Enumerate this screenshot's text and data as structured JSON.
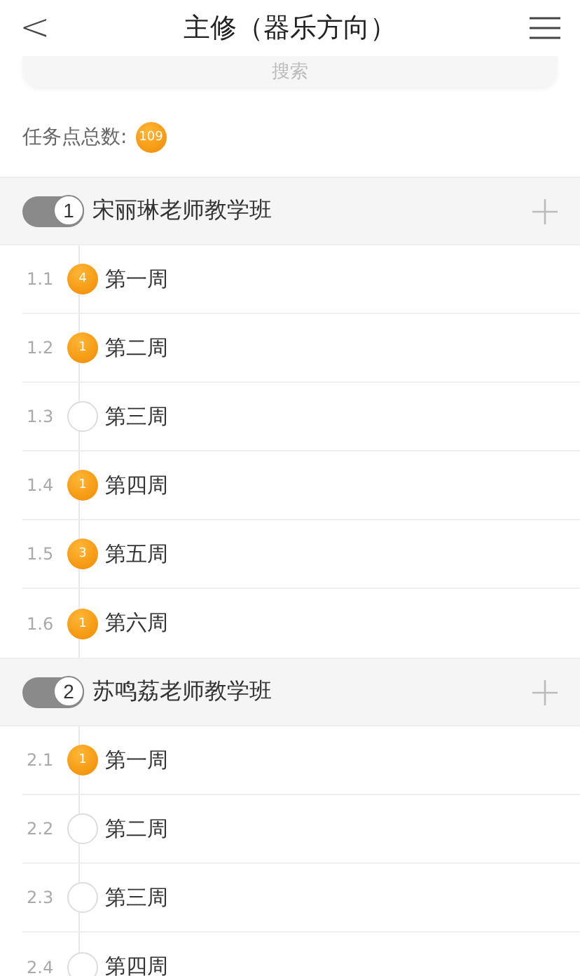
{
  "header": {
    "back": "<",
    "title": "主修（器乐方向）"
  },
  "search": {
    "placeholder": "搜索"
  },
  "total": {
    "label": "任务点总数:",
    "count": "109"
  },
  "sections": [
    {
      "number": "1",
      "title": "宋丽琳老师教学班",
      "items": [
        {
          "index": "1.1",
          "label": "第一周",
          "count": "4"
        },
        {
          "index": "1.2",
          "label": "第二周",
          "count": "1"
        },
        {
          "index": "1.3",
          "label": "第三周"
        },
        {
          "index": "1.4",
          "label": "第四周",
          "count": "1"
        },
        {
          "index": "1.5",
          "label": "第五周",
          "count": "3"
        },
        {
          "index": "1.6",
          "label": "第六周",
          "count": "1"
        }
      ]
    },
    {
      "number": "2",
      "title": "苏鸣荔老师教学班",
      "items": [
        {
          "index": "2.1",
          "label": "第一周",
          "count": "1"
        },
        {
          "index": "2.2",
          "label": "第二周"
        },
        {
          "index": "2.3",
          "label": "第三周"
        },
        {
          "index": "2.4",
          "label": "第四周"
        }
      ]
    }
  ]
}
